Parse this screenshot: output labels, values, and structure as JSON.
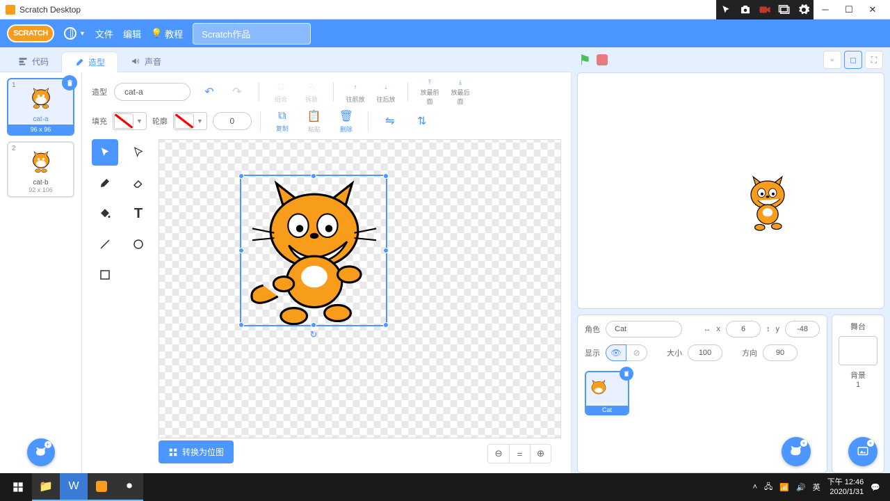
{
  "window": {
    "title": "Scratch Desktop"
  },
  "menu": {
    "file": "文件",
    "edit": "编辑",
    "tutorials": "教程",
    "project_name": "Scratch作品"
  },
  "tabs": {
    "code": "代码",
    "costumes": "造型",
    "sounds": "声音"
  },
  "costumes": [
    {
      "name": "cat-a",
      "size": "96 x 96"
    },
    {
      "name": "cat-b",
      "size": "92 x 106"
    }
  ],
  "paint": {
    "label_costume": "造型",
    "costume_name": "cat-a",
    "label_fill": "填充",
    "label_outline": "轮廓",
    "outline_width": "0",
    "group": "组合",
    "ungroup": "拆散",
    "forward": "往前放",
    "backward": "往后放",
    "front": "放最前面",
    "back": "放最后面",
    "copy": "复制",
    "paste": "粘贴",
    "delete": "删除",
    "flip_h": "",
    "flip_v": "",
    "convert": "转换为位图"
  },
  "sprite": {
    "label_sprite": "角色",
    "name": "Cat",
    "x_label": "x",
    "x": "6",
    "y_label": "y",
    "y": "-48",
    "label_show": "显示",
    "label_size": "大小",
    "size": "100",
    "label_direction": "方向",
    "direction": "90",
    "thumb_name": "Cat"
  },
  "stage_panel": {
    "title": "舞台",
    "backdrops_label": "背景",
    "backdrop_count": "1"
  },
  "taskbar": {
    "ime": "英",
    "time": "下午 12:46",
    "date": "2020/1/31"
  }
}
